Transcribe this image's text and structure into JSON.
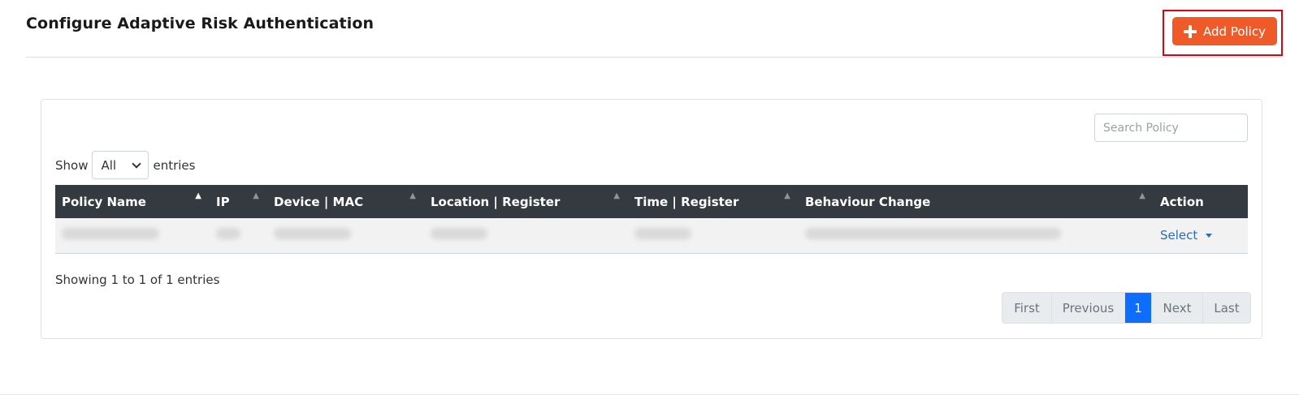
{
  "header": {
    "title": "Configure Adaptive Risk Authentication",
    "add_button_label": "Add Policy"
  },
  "search": {
    "placeholder": "Search Policy"
  },
  "length": {
    "prefix": "Show",
    "selected": "All",
    "suffix": "entries"
  },
  "table": {
    "columns": [
      "Policy Name",
      "IP",
      "Device | MAC",
      "Location | Register",
      "Time | Register",
      "Behaviour Change",
      "Action"
    ],
    "row_action_label": "Select"
  },
  "info": "Showing 1 to 1 of 1 entries",
  "pagination": {
    "first": "First",
    "previous": "Previous",
    "current": "1",
    "next": "Next",
    "last": "Last"
  },
  "colors": {
    "accent": "#f05a28",
    "highlight": "#e3000f",
    "header_bg": "#343a40",
    "active_page": "#0d6efd"
  }
}
